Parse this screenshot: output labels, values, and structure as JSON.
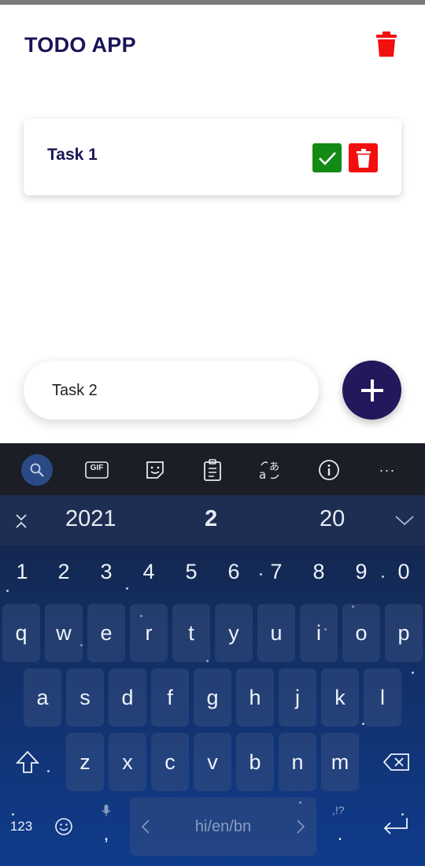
{
  "app": {
    "title": "TODO APP",
    "tasks": [
      {
        "text": "Task 1"
      }
    ],
    "input": {
      "value": "Task 2"
    },
    "add_label": "+"
  },
  "colors": {
    "title": "#1a1456",
    "done_button": "#138a13",
    "delete_button": "#f20f0f",
    "add_button": "#22185c"
  },
  "keyboard": {
    "toolbar_icons": [
      "search-icon",
      "gif-icon",
      "sticker-icon",
      "clipboard-icon",
      "translate-icon",
      "info-icon",
      "more-icon"
    ],
    "gif_label": "GIF",
    "more_label": "···",
    "suggestions": [
      "2021",
      "2",
      "20"
    ],
    "numbers": [
      "1",
      "2",
      "3",
      "4",
      "5",
      "6",
      "7",
      "8",
      "9",
      "0"
    ],
    "row1": [
      "q",
      "w",
      "e",
      "r",
      "t",
      "y",
      "u",
      "i",
      "o",
      "p"
    ],
    "row2": [
      "a",
      "s",
      "d",
      "f",
      "g",
      "h",
      "j",
      "k",
      "l"
    ],
    "row3": [
      "z",
      "x",
      "c",
      "v",
      "b",
      "n",
      "m"
    ],
    "bottom": {
      "symbols": "123",
      "space_label": "hi/en/bn",
      "period": ".",
      "comma": ",",
      "punct_hint": ",!?"
    }
  }
}
